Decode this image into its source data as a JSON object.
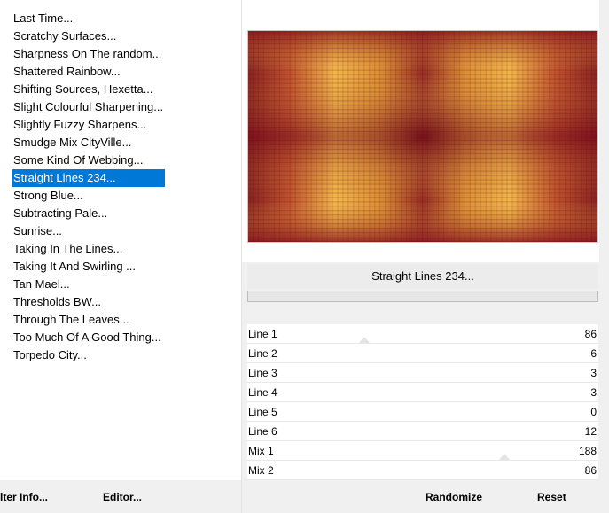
{
  "filters": [
    "Last Time...",
    "Scratchy Surfaces...",
    "Sharpness On The random...",
    "Shattered Rainbow...",
    "Shifting Sources, Hexetta...",
    "Slight Colourful Sharpening...",
    "Slightly Fuzzy Sharpens...",
    "Smudge Mix CityVille...",
    "Some Kind Of Webbing...",
    "Straight Lines 234...",
    "Strong Blue...",
    "Subtracting Pale...",
    "Sunrise...",
    "Taking In The Lines...",
    "Taking It And Swirling ...",
    "Tan Mael...",
    "Thresholds BW...",
    "Through The Leaves...",
    "Too Much Of A Good Thing...",
    "Torpedo City..."
  ],
  "selected_index": 9,
  "preview": {
    "filter_name": "Straight Lines 234...",
    "colors": {
      "light": "#f3b84a",
      "mid": "#d8892e",
      "dark": "#7a0f1c"
    }
  },
  "progress_fraction": 0,
  "params": [
    {
      "label": "Line 1",
      "value": "86"
    },
    {
      "label": "Line 2",
      "value": "6"
    },
    {
      "label": "Line 3",
      "value": "3"
    },
    {
      "label": "Line 4",
      "value": "3"
    },
    {
      "label": "Line 5",
      "value": "0"
    },
    {
      "label": "Line 6",
      "value": "12"
    },
    {
      "label": "Mix 1",
      "value": "188"
    },
    {
      "label": "Mix 2",
      "value": "86"
    }
  ],
  "buttons": {
    "filter_info": "lter Info...",
    "editor": "Editor...",
    "randomize": "Randomize",
    "reset": "Reset"
  }
}
